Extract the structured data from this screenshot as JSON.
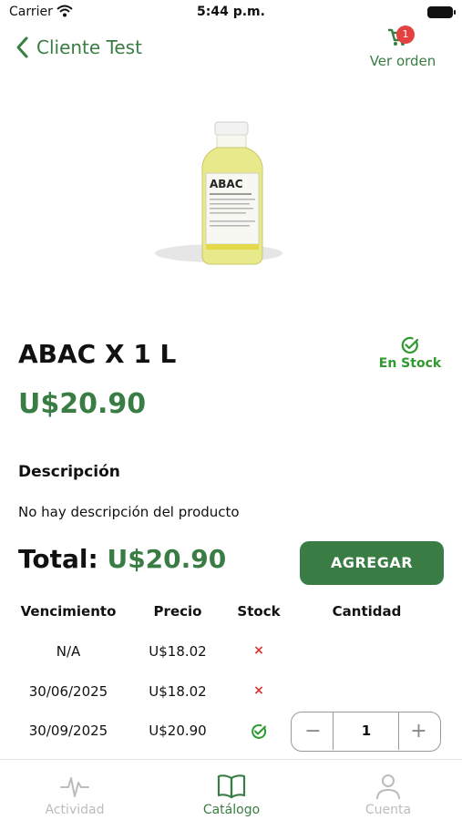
{
  "status_bar": {
    "carrier": "Carrier",
    "time": "5:44 p.m."
  },
  "nav": {
    "back_label": "Cliente Test",
    "cart_count": "1",
    "cart_label": "Ver orden"
  },
  "product": {
    "name": "ABAC X 1 L",
    "price": "U$20.90",
    "stock_label": "En Stock",
    "bottle_label": "ABAC"
  },
  "description": {
    "title": "Descripción",
    "text": "No hay descripción del producto"
  },
  "total": {
    "label": "Total:",
    "value": "U$20.90"
  },
  "add_button": "AGREGAR",
  "table": {
    "headers": [
      "Vencimiento",
      "Precio",
      "Stock",
      "Cantidad"
    ],
    "rows": [
      {
        "vencimiento": "N/A",
        "precio": "U$18.02",
        "stock": "×"
      },
      {
        "vencimiento": "30/06/2025",
        "precio": "U$18.02",
        "stock": "×"
      },
      {
        "vencimiento": "30/09/2025",
        "precio": "U$20.90",
        "stock": "check"
      }
    ],
    "quantity": {
      "minus": "−",
      "value": "1",
      "plus": "+"
    }
  },
  "tabs": [
    {
      "label": "Actividad",
      "icon": "activity-icon",
      "active": false
    },
    {
      "label": "Catálogo",
      "icon": "book-icon",
      "active": true
    },
    {
      "label": "Cuenta",
      "icon": "user-icon",
      "active": false
    }
  ],
  "colors": {
    "brand": "#3a7d44",
    "stock_ok": "#2f9a2f",
    "out": "#e03030",
    "badge": "#e54040"
  }
}
